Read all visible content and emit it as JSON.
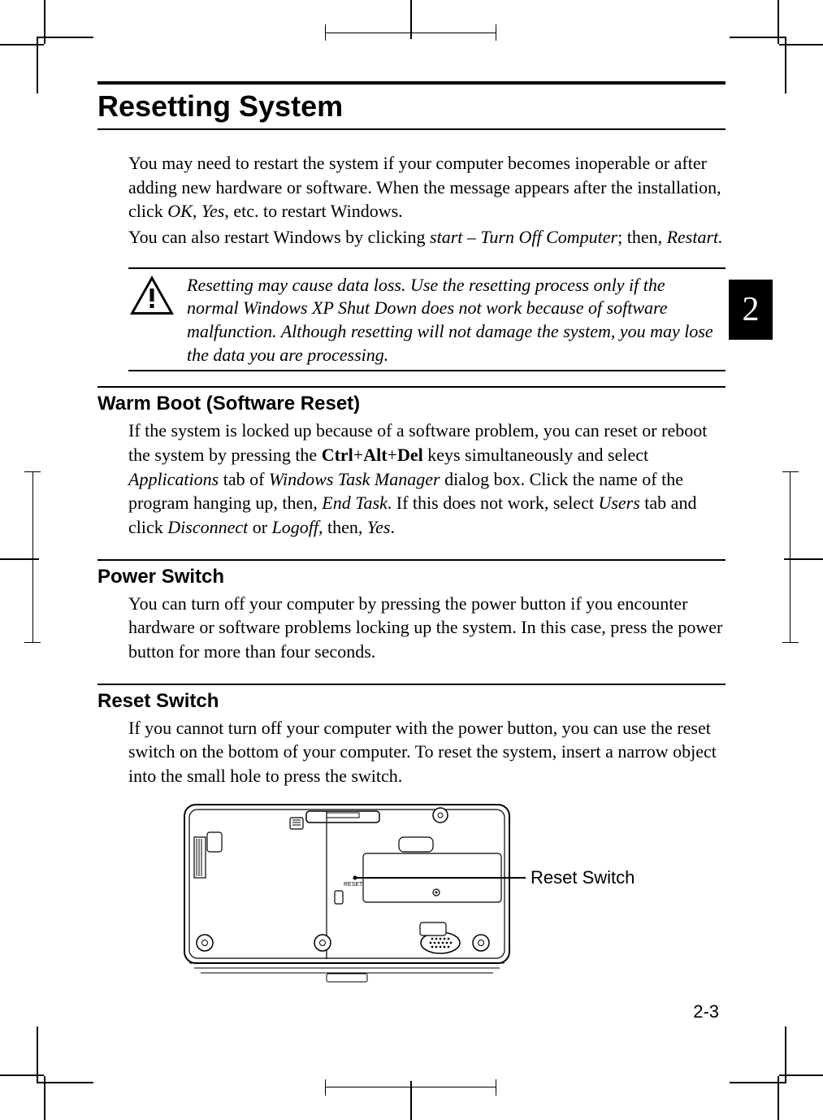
{
  "title": "Resetting System",
  "intro_p1": "You may need to restart the system if your computer becomes inoperable or after adding new hardware or software. When the message appears after the installation, click ",
  "intro_ok": "OK",
  "intro_sep1": ", ",
  "intro_yes": "Yes",
  "intro_p1b": ", etc. to restart Windows.",
  "intro_p2a": "You can also restart Windows by clicking ",
  "intro_start": "start – Turn Off Computer",
  "intro_sep2": "; then, ",
  "intro_restart": "Restart.",
  "note": "Resetting may cause data loss. Use the resetting process only if the normal Windows XP Shut Down does not work because of software malfunction. Although resetting will not damage the system, you may lose the data you are processing.",
  "warm_h": "Warm Boot (Software Reset)",
  "warm_a": "If the system is locked up because of a software problem, you can reset or reboot the system by pressing the ",
  "warm_keys_ctrl": "Ctrl",
  "warm_plus": "+",
  "warm_keys_alt": "Alt",
  "warm_keys_del": "Del",
  "warm_b": " keys simultaneously and select ",
  "warm_apps": "Applications",
  "warm_c": " tab of ",
  "warm_wtm": "Windows Task Manager",
  "warm_d": " dialog box. Click the name of the program hanging up, then, ",
  "warm_end": "End Task",
  "warm_e": ". If this does not work, select ",
  "warm_users": "Users",
  "warm_f": " tab and click ",
  "warm_disc": "Disconnect",
  "warm_g": " or ",
  "warm_logoff": "Logoff",
  "warm_h2": ", then, ",
  "warm_yes": "Yes",
  "warm_i": ".",
  "power_h": "Power Switch",
  "power_body": "You can turn off your computer by pressing the power button if you encounter hardware or software problems locking up the system. In this case, press the power button for more than four seconds.",
  "reset_h": "Reset Switch",
  "reset_body": "If you cannot turn off your computer with the power button, you can use the reset switch on the bottom of your computer. To reset the system, insert a narrow object into the small hole to press the switch.",
  "diagram_reset_tiny": "RESET",
  "diagram_callout": "Reset Switch",
  "side_tab": "2",
  "page_num": "2-3"
}
